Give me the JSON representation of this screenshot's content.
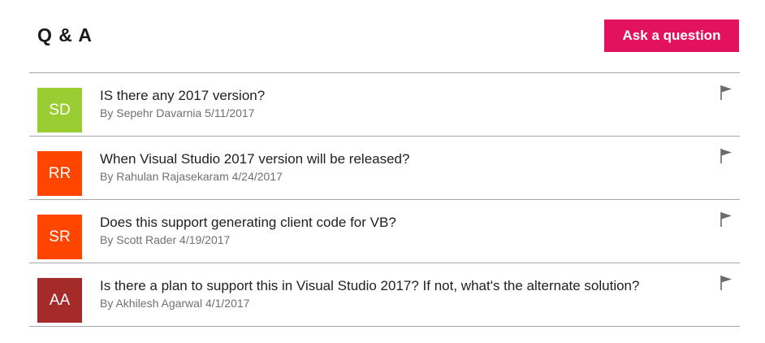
{
  "header": {
    "title": "Q & A",
    "ask_label": "Ask a question"
  },
  "questions": [
    {
      "initials": "SD",
      "avatar_color": "#9acd32",
      "title": "IS there any 2017 version?",
      "byline": "By Sepehr Davarnia 5/11/2017",
      "flag_icon": "flag-icon"
    },
    {
      "initials": "RR",
      "avatar_color": "#ff4500",
      "title": "When Visual Studio 2017 version will be released?",
      "byline": "By Rahulan Rajasekaram 4/24/2017",
      "flag_icon": "flag-icon"
    },
    {
      "initials": "SR",
      "avatar_color": "#ff4500",
      "title": "Does this support generating client code for VB?",
      "byline": "By Scott Rader 4/19/2017",
      "flag_icon": "flag-icon"
    },
    {
      "initials": "AA",
      "avatar_color": "#a52a2a",
      "title": "Is there a plan to support this in Visual Studio 2017? If not, what's the alternate solution?",
      "byline": "By Akhilesh Agarwal 4/1/2017",
      "flag_icon": "flag-icon"
    }
  ],
  "colors": {
    "accent": "#e3125f",
    "divider": "#a8a8a8",
    "meta_text": "#707070"
  }
}
